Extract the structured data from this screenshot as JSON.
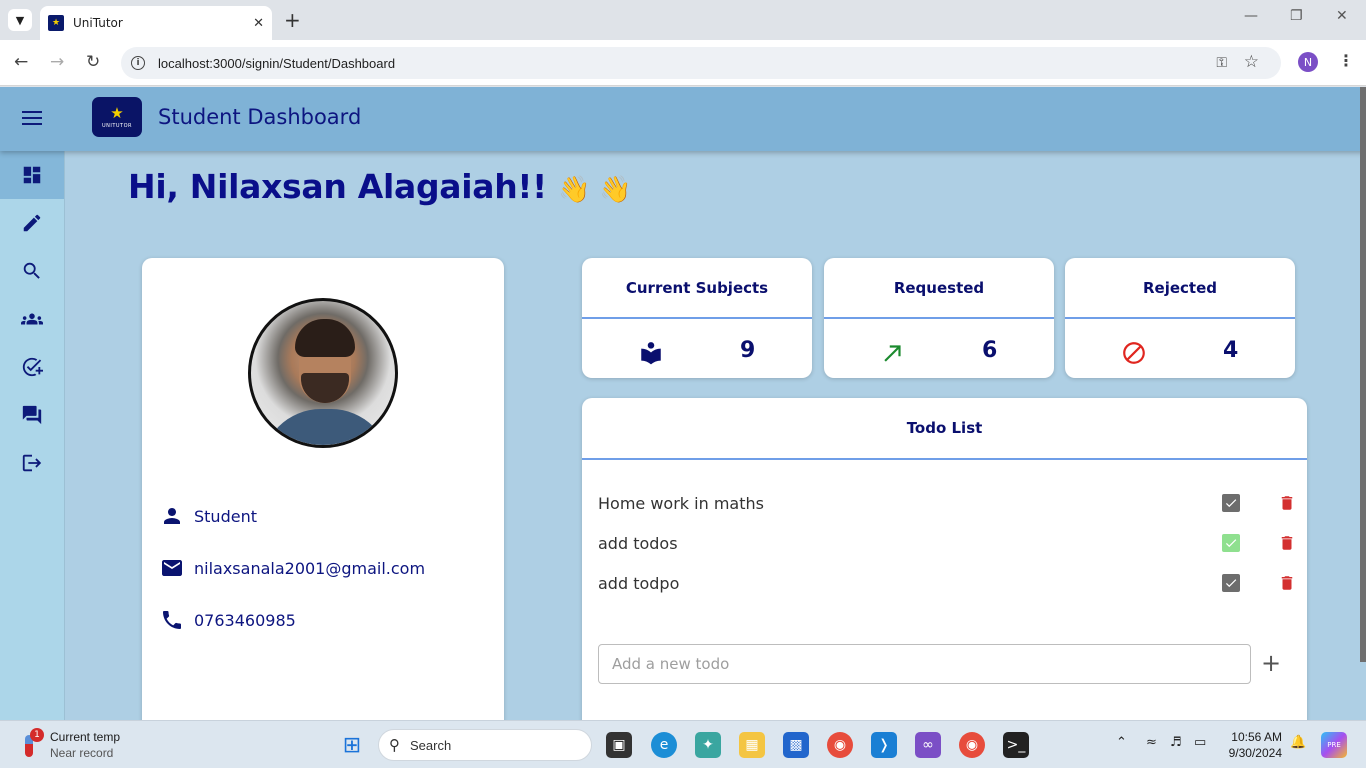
{
  "browser": {
    "tab_title": "UniTutor",
    "url": "localhost:3000/signin/Student/Dashboard",
    "profile_initial": "N"
  },
  "header": {
    "title": "Student Dashboard",
    "logo_text": "UNITUTOR"
  },
  "sidebar": {
    "items": [
      {
        "name": "dashboard-icon",
        "active": true
      },
      {
        "name": "pencil-icon",
        "active": false
      },
      {
        "name": "search-icon",
        "active": false
      },
      {
        "name": "groups-icon",
        "active": false
      },
      {
        "name": "task-check-icon",
        "active": false
      },
      {
        "name": "chat-icon",
        "active": false
      },
      {
        "name": "logout-icon",
        "active": false
      }
    ]
  },
  "greeting": {
    "text": "Hi, Nilaxsan Alagaiah!!",
    "emoji": "👋 👋"
  },
  "profile": {
    "role": "Student",
    "email": "nilaxsanala2001@gmail.com",
    "phone": "0763460985"
  },
  "stats": [
    {
      "title": "Current Subjects",
      "value": "9",
      "icon": "book-reader-icon",
      "color": "#0a0f6e"
    },
    {
      "title": "Requested",
      "value": "6",
      "icon": "arrow-up-right-icon",
      "color": "#1b8a2e"
    },
    {
      "title": "Rejected",
      "value": "4",
      "icon": "block-icon",
      "color": "#e0261f"
    }
  ],
  "todo": {
    "title": "Todo List",
    "items": [
      {
        "text": "Home work in maths",
        "done": false
      },
      {
        "text": "add todos",
        "done": true
      },
      {
        "text": "add todpo",
        "done": false
      }
    ],
    "input_placeholder": "Add a new todo",
    "add_label": "+"
  },
  "taskbar": {
    "weather_badge": "1",
    "weather_title": "Current temp",
    "weather_subtitle": "Near record",
    "search_label": "Search",
    "time": "10:56 AM",
    "date": "9/30/2024",
    "copilot_badge": "PRE"
  }
}
